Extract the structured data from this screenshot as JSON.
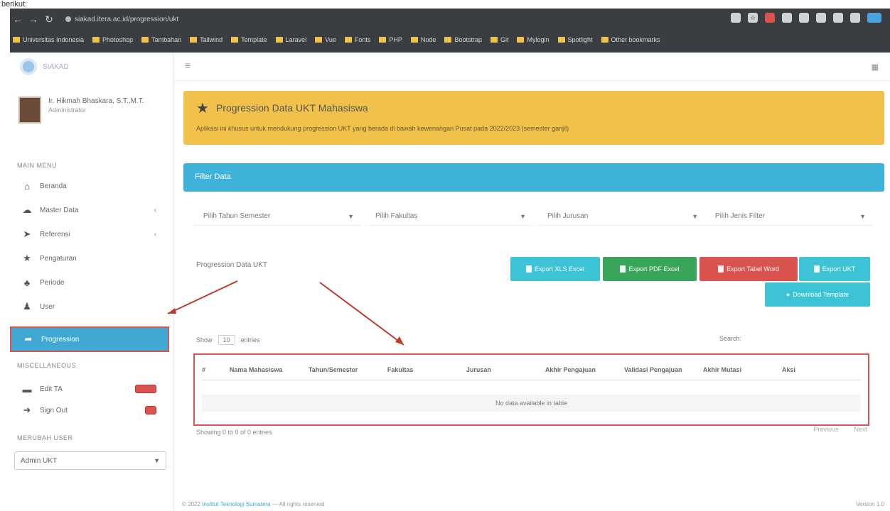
{
  "caption": "berikut:",
  "browser": {
    "url": "siakad.itera.ac.id/progression/ukt",
    "bookmarks": [
      "Universitas Indonesia",
      "Photoshop",
      "Tambahan",
      "Tailwind",
      "Template",
      "Laravel",
      "Vue",
      "Fonts",
      "PHP",
      "Node",
      "Bootstrap",
      "Git",
      "Mylogin",
      "Spotlight",
      "Other bookmarks"
    ]
  },
  "sidebar": {
    "logo_text": "SIAKAD",
    "user_name": "Ir. Hikmah Bhaskara, S.T.,M.T.",
    "user_role": "Administrator",
    "main_menu_label": "MAIN MENU",
    "items": [
      {
        "label": "Beranda",
        "icon": "home-icon",
        "glyph": "⌂",
        "chevron": false
      },
      {
        "label": "Master Data",
        "icon": "cloud-icon",
        "glyph": "☁",
        "chevron": true
      },
      {
        "label": "Referensi",
        "icon": "send-icon",
        "glyph": "➤",
        "chevron": true
      },
      {
        "label": "Pengaturan",
        "icon": "star-icon",
        "glyph": "★",
        "chevron": false
      },
      {
        "label": "Periode",
        "icon": "group-icon",
        "glyph": "♣",
        "chevron": false
      },
      {
        "label": "User",
        "icon": "user-icon",
        "glyph": "♟",
        "chevron": false
      }
    ],
    "active_item": {
      "label": "Progression",
      "glyph": "➦"
    },
    "misc_label": "MISCELLANEOUS",
    "misc_items": [
      {
        "label": "Edit TA",
        "glyph": "▬"
      },
      {
        "label": "Sign Out",
        "glyph": "➜"
      }
    ],
    "lang_label": "MERUBAH USER",
    "lang_value": "Admin UKT"
  },
  "alert": {
    "title": "Progression Data UKT Mahasiswa",
    "text": "Aplikasi ini khusus untuk mendukung progression UKT yang berada di bawah kewenangan Pusat pada 2022/2023 (semester ganjil)"
  },
  "filter": {
    "title": "Filter Data",
    "selects": [
      "Pilih Tahun Semester",
      "Pilih Fakultas",
      "Pilih Jurusan",
      "Pilih Jenis Filter"
    ]
  },
  "card": {
    "title": "Progression Data UKT",
    "buttons": [
      "Export XLS Excel",
      "Export PDF Excel",
      "Export Tabel Word",
      "Export UKT",
      "Download Template"
    ]
  },
  "table": {
    "show_label": "Show",
    "show_value": "10",
    "entries_label": "entries",
    "search_label": "Search:",
    "columns": [
      "#",
      "Nama Mahasiswa",
      "Tahun/Semester",
      "Fakultas",
      "Jurusan",
      "Akhir Pengajuan",
      "Validasi Pengajuan",
      "Akhir Mutasi",
      "Aksi"
    ],
    "empty": "No data available in table",
    "info": "Showing 0 to 0 of 0 entries",
    "prev": "Previous",
    "next": "Next"
  },
  "footer": {
    "prefix": "© 2022",
    "link": "Institut Teknologi Sumatera",
    "suffix": " — All rights reserved",
    "version": "Version 1.0"
  },
  "colors": {
    "accent": "#3fb2d9",
    "alert": "#f0c14b",
    "highlight": "#d9534f",
    "green": "#3aa55a"
  }
}
